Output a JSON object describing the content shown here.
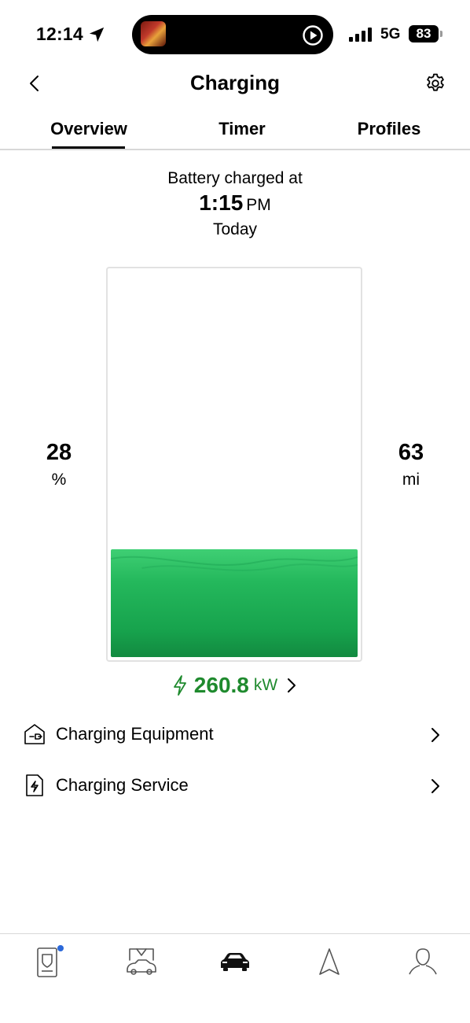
{
  "status_bar": {
    "time": "12:14",
    "network": "5G",
    "battery_level": "83"
  },
  "header": {
    "title": "Charging"
  },
  "tabs": [
    {
      "label": "Overview",
      "active": true
    },
    {
      "label": "Timer",
      "active": false
    },
    {
      "label": "Profiles",
      "active": false
    }
  ],
  "charge_info": {
    "label": "Battery charged at",
    "time": "1:15",
    "ampm": "PM",
    "day": "Today"
  },
  "battery": {
    "state_of_charge": "28",
    "soc_unit": "%",
    "fill_fraction": 0.28,
    "range": "63",
    "range_unit": "mi",
    "fill_color": "#1fae56"
  },
  "power": {
    "value": "260.8",
    "unit": "kW",
    "color": "#1f8a2e"
  },
  "list": [
    {
      "label": "Charging Equipment",
      "icon": "charging-equipment-icon"
    },
    {
      "label": "Charging Service",
      "icon": "charging-service-icon"
    }
  ],
  "bottom_nav": [
    {
      "icon": "phone-key-icon",
      "badge": true,
      "badge_color": "#2b68d9"
    },
    {
      "icon": "garage-icon"
    },
    {
      "icon": "car-icon",
      "active": true
    },
    {
      "icon": "navigation-icon"
    },
    {
      "icon": "profile-icon"
    }
  ]
}
